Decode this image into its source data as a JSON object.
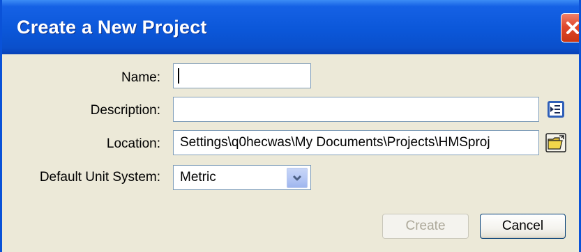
{
  "window": {
    "title": "Create a New Project"
  },
  "form": {
    "name": {
      "label": "Name:",
      "value": ""
    },
    "description": {
      "label": "Description:",
      "value": ""
    },
    "location": {
      "label": "Location:",
      "value": "Settings\\q0hecwas\\My Documents\\Projects\\HMSproj"
    },
    "unit_system": {
      "label": "Default Unit System:",
      "selected": "Metric"
    }
  },
  "buttons": {
    "create": "Create",
    "cancel": "Cancel"
  },
  "icons": {
    "close": "close-icon",
    "description_editor": "text-editor-icon",
    "browse_folder": "open-folder-icon",
    "dropdown": "chevron-down-icon"
  },
  "colors": {
    "titlebar": "#0a52d8",
    "close_button": "#e0482c",
    "dialog_background": "#ece9d8",
    "field_border": "#7f9db9"
  }
}
